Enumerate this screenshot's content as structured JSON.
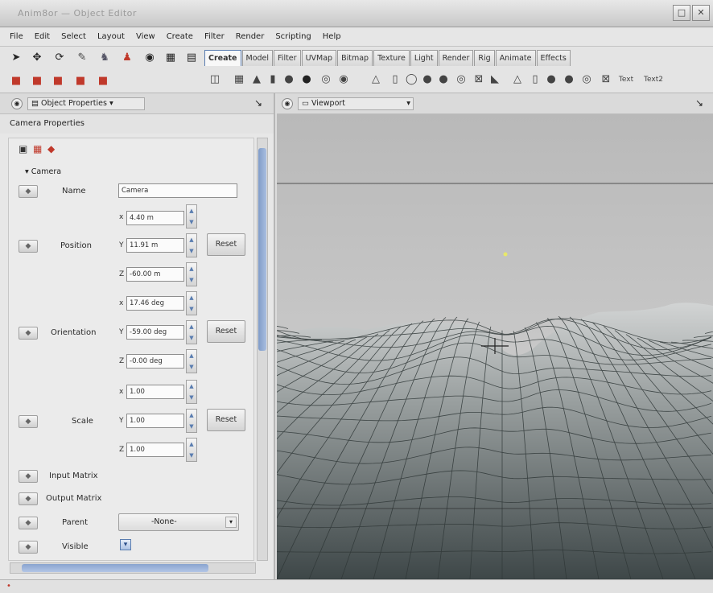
{
  "window": {
    "title": "Anim8or — Object Editor",
    "btn_maximize": "□",
    "btn_close": "✕"
  },
  "menu": [
    "File",
    "Edit",
    "Select",
    "Layout",
    "View",
    "Create",
    "Filter",
    "Render",
    "Scripting",
    "Help"
  ],
  "tabs": [
    "Create",
    "Model",
    "Filter",
    "UVMap",
    "Bitmap",
    "Texture",
    "Light",
    "Render",
    "Rig",
    "Animate",
    "Effects"
  ],
  "active_tab": "Create",
  "primitive_labels": {
    "text1": "Text",
    "text2": "Text2"
  },
  "left_panel": {
    "dropdown_label": "Object Properties",
    "section_title": "Camera Properties",
    "group_label": "Camera",
    "name_label": "Name",
    "name_value": "Camera",
    "position": {
      "label": "Position",
      "x": "4.40 m",
      "y": "11.91 m",
      "z": "-60.00 m",
      "reset": "Reset"
    },
    "orientation": {
      "label": "Orientation",
      "x": "17.46 deg",
      "y": "-59.00 deg",
      "z": "-0.00 deg",
      "reset": "Reset"
    },
    "scale": {
      "label": "Scale",
      "x": "1.00",
      "y": "1.00",
      "z": "1.00",
      "reset": "Reset"
    },
    "input_matrix_label": "Input Matrix",
    "output_matrix_label": "Output Matrix",
    "parent_label": "Parent",
    "parent_value": "-None-",
    "visible_label": "Visible"
  },
  "viewport": {
    "dropdown_label": "Viewport"
  },
  "colors": {
    "accent": "#5a7db0",
    "scroll": "#8ca6d2",
    "ground_dark": "#4b5456",
    "ground_light": "#c5c8c8",
    "sky": "#bcbcbc"
  }
}
